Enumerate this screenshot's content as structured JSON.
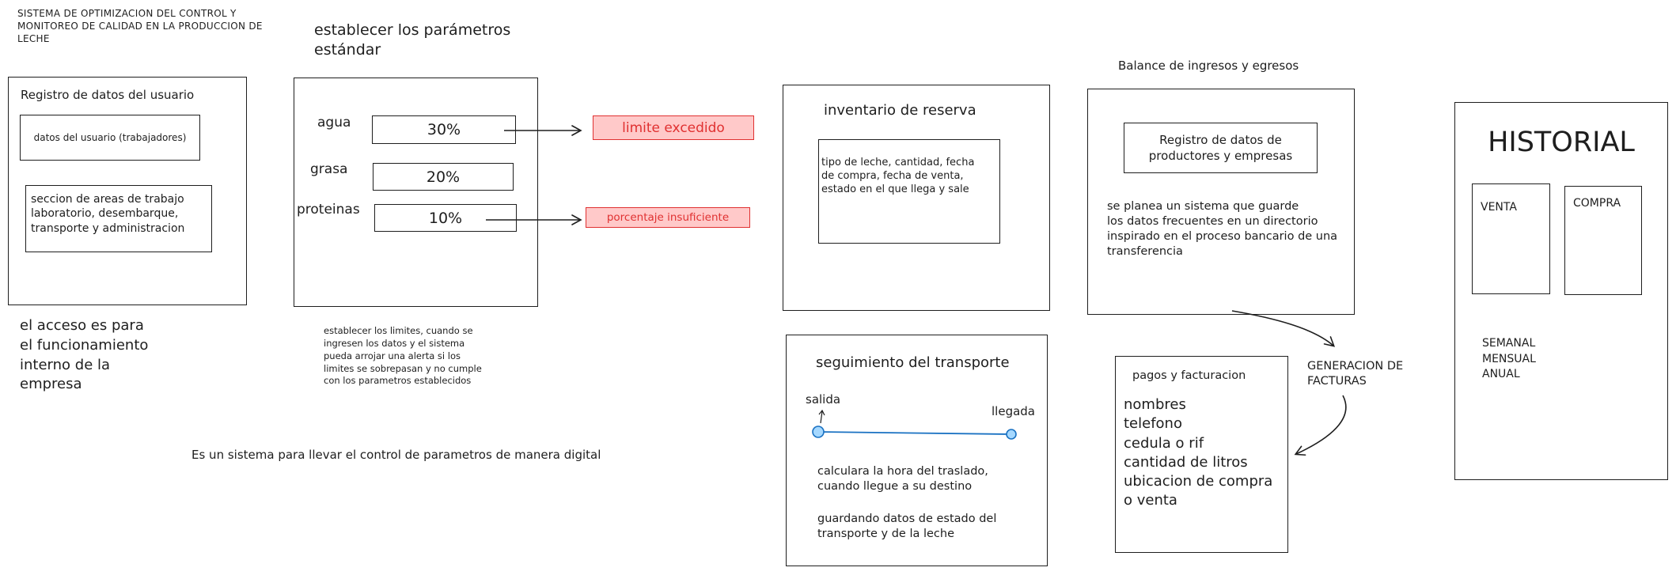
{
  "header": {
    "system_title": "SISTEMA DE OPTIMIZACION DEL CONTROL Y\nMONITOREO DE CALIDAD EN LA PRODUCCION DE\nLECHE",
    "params_heading": "establecer los parámetros\nestándar",
    "balance_heading": "Balance de ingresos y egresos"
  },
  "user_panel": {
    "title": "Registro de datos del usuario",
    "data_box": "datos del usuario (trabajadores)",
    "areas_box": "seccion de areas de trabajo\nlaboratorio, desembarque,\ntransporte y administracion",
    "access_note": "el acceso es para\nel funcionamiento\ninterno de la\nempresa"
  },
  "params_panel": {
    "rows": [
      {
        "label": "agua",
        "value": "30%"
      },
      {
        "label": "grasa",
        "value": "20%"
      },
      {
        "label": "proteinas",
        "value": "10%"
      }
    ],
    "alerts": {
      "exceeded": "limite excedido",
      "insufficient": "porcentaje insuficiente"
    },
    "note": "establecer los limites, cuando se\ningresen los datos y el sistema\npueda arrojar una alerta si los\nlimites se sobrepasan y no cumple\ncon los parametros establecidos"
  },
  "footer_note": "Es un sistema para llevar el control de parametros de manera digital",
  "inventory_panel": {
    "title": "inventario de reserva",
    "details": "tipo de leche, cantidad,  fecha\nde compra, fecha de venta,\nestado en el que llega y sale"
  },
  "transport_panel": {
    "title": "seguimiento del transporte",
    "start_label": "salida",
    "end_label": "llegada",
    "note_time": "calculara la hora del traslado,\ncuando llegue a su destino",
    "note_status": "guardando datos de estado del\ntransporte y de la leche"
  },
  "balance_panel": {
    "registry_box": "Registro de datos de\nproductores y empresas",
    "description": "se planea un sistema que guarde\nlos datos frecuentes en un directorio\ninspirado en el proceso bancario de una\ntransferencia",
    "invoice_label": "GENERACION DE\nFACTURAS"
  },
  "billing_panel": {
    "title": "pagos y facturacion",
    "fields": "nombres\ntelefono\ncedula o rif\ncantidad de litros\nubicacion de compra\no venta"
  },
  "history_panel": {
    "title": "HISTORIAL",
    "sale": "VENTA",
    "purchase": "COMPRA",
    "periods": "SEMANAL\nMENSUAL\nANUAL"
  },
  "colors": {
    "stroke": "#1e1e1e",
    "alert_fill": "#ffc9c9",
    "alert_text": "#e03131",
    "route_line": "#1971c2",
    "route_node": "#a5d8ff"
  }
}
